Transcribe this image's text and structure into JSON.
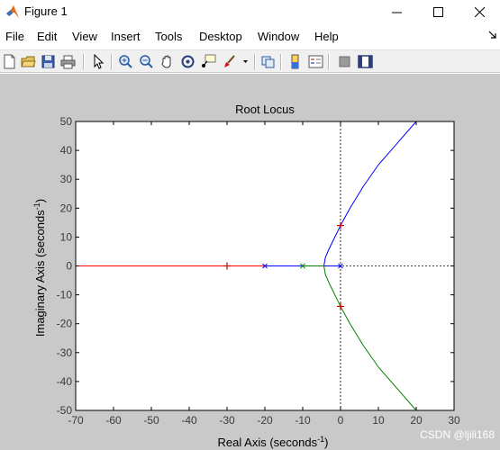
{
  "window": {
    "title": "Figure 1",
    "minimize_icon": "minimize-icon",
    "maximize_icon": "maximize-icon",
    "close_icon": "close-icon"
  },
  "menu": {
    "items": [
      "File",
      "Edit",
      "View",
      "Insert",
      "Tools",
      "Desktop",
      "Window",
      "Help"
    ]
  },
  "toolbar": {
    "icons": [
      "new-figure-icon",
      "open-file-icon",
      "save-icon",
      "print-icon",
      "pointer-icon",
      "zoom-in-icon",
      "zoom-out-icon",
      "pan-hand-icon",
      "rotate-3d-icon",
      "data-cursor-icon",
      "brush-icon",
      "link-plot-icon",
      "colorbar-icon",
      "legend-icon",
      "hide-plot-tools-icon",
      "show-plot-tools-icon"
    ]
  },
  "watermark": "CSDN @ljili168",
  "chart_data": {
    "type": "line",
    "title": "Root Locus",
    "xlabel_prefix": "Real Axis (seconds",
    "ylabel_prefix": "Imaginary Axis (seconds",
    "unit_exponent": "-1",
    "xlim": [
      -70,
      30
    ],
    "ylim": [
      -50,
      50
    ],
    "xticks": [
      "-70",
      "-60",
      "-50",
      "-40",
      "-30",
      "-20",
      "-10",
      "0",
      "10",
      "20",
      "30"
    ],
    "yticks": [
      "50",
      "40",
      "30",
      "20",
      "10",
      "0",
      "-10",
      "-20",
      "-30",
      "-40",
      "-50"
    ],
    "grid": false,
    "series": [
      {
        "color": "#ff0000",
        "points": [
          [
            -20,
            0
          ],
          [
            -70,
            0
          ]
        ]
      },
      {
        "color": "#0000ff",
        "points": [
          [
            -20,
            0
          ],
          [
            -10,
            0
          ]
        ]
      },
      {
        "color": "#008000",
        "points": [
          [
            -10,
            0
          ],
          [
            -4.4,
            0
          ]
        ]
      },
      {
        "color": "#0000ff",
        "points": [
          [
            0,
            0
          ],
          [
            -4.4,
            0
          ]
        ]
      },
      {
        "color": "#0000ff",
        "points": [
          [
            -4.4,
            0
          ],
          [
            -4,
            3
          ],
          [
            -3,
            6
          ],
          [
            -1.5,
            10
          ],
          [
            0,
            14
          ],
          [
            2.5,
            20
          ],
          [
            6,
            27.5
          ],
          [
            10,
            35
          ],
          [
            15,
            42.5
          ],
          [
            20,
            50
          ]
        ]
      },
      {
        "color": "#008000",
        "points": [
          [
            -4.4,
            0
          ],
          [
            -4,
            -3
          ],
          [
            -3,
            -6
          ],
          [
            -1.5,
            -10
          ],
          [
            0,
            -14
          ],
          [
            2.5,
            -20
          ],
          [
            6,
            -27.5
          ],
          [
            10,
            -35
          ],
          [
            15,
            -42.5
          ],
          [
            20,
            -50
          ]
        ]
      }
    ],
    "poles": [
      {
        "x": 0,
        "y": 0,
        "color": "#0000ff"
      },
      {
        "x": -10,
        "y": 0,
        "color": "#008000"
      },
      {
        "x": -20,
        "y": 0,
        "color": "#0000ff"
      }
    ],
    "plus_markers": [
      {
        "x": 0,
        "y": 14,
        "color": "#cc0000"
      },
      {
        "x": 0,
        "y": -14,
        "color": "#cc0000"
      },
      {
        "x": -30,
        "y": 0,
        "color": "#cc0000"
      }
    ],
    "dashed_zero_lines": true
  }
}
